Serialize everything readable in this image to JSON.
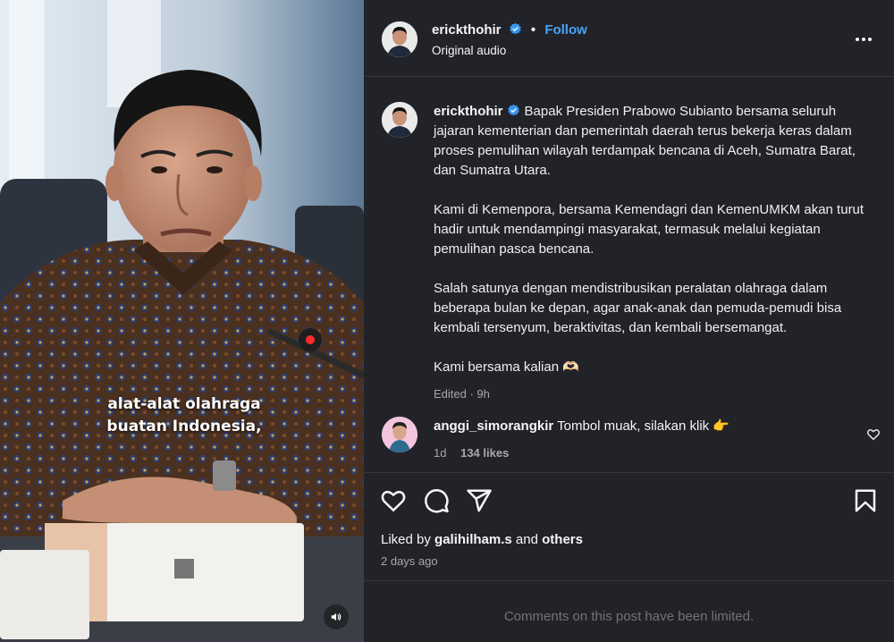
{
  "media": {
    "caption_line1": "alat-alat olahraga",
    "caption_line2": "buatan Indonesia,"
  },
  "header": {
    "username": "erickthohir",
    "separator": "•",
    "follow_label": "Follow",
    "subtitle": "Original audio"
  },
  "post": {
    "username": "erickthohir",
    "paragraph1": "Bapak Presiden Prabowo Subianto bersama seluruh jajaran kementerian dan pemerintah daerah terus bekerja keras dalam proses pemulihan wilayah terdampak bencana di Aceh, Sumatra Barat, dan Sumatra Utara.",
    "paragraph2": "Kami di Kemenpora, bersama Kemendagri dan KemenUMKM akan turut hadir untuk mendampingi masyarakat, termasuk melalui kegiatan pemulihan pasca bencana.",
    "paragraph3": "Salah satunya dengan mendistribusikan peralatan olahraga dalam beberapa bulan ke depan, agar anak-anak dan pemuda-pemudi bisa kembali tersenyum, beraktivitas, dan kembali bersemangat.",
    "paragraph4": "Kami bersama kalian 🫶🏻",
    "edited": "Edited · 9h"
  },
  "comment": {
    "username": "anggi_simorangkir",
    "text": "Tombol muak, silakan klik 👉",
    "age": "1d",
    "likes": "134 likes"
  },
  "actions": {
    "liked_by_prefix": "Liked by ",
    "liked_by_user": "galihilham.s",
    "liked_by_and": " and ",
    "liked_by_others": "others",
    "time_ago": "2 days ago"
  },
  "footer": {
    "limited_text": "Comments on this post have been limited."
  },
  "colors": {
    "panel_bg": "#212328",
    "link_blue": "#4aa3f7",
    "verified_blue": "#3897f0",
    "muted_text": "#a8a8a8"
  },
  "icons": [
    "verified-badge-icon",
    "more-options-icon",
    "heart-icon",
    "comment-icon",
    "share-icon",
    "bookmark-icon",
    "speaker-icon"
  ]
}
